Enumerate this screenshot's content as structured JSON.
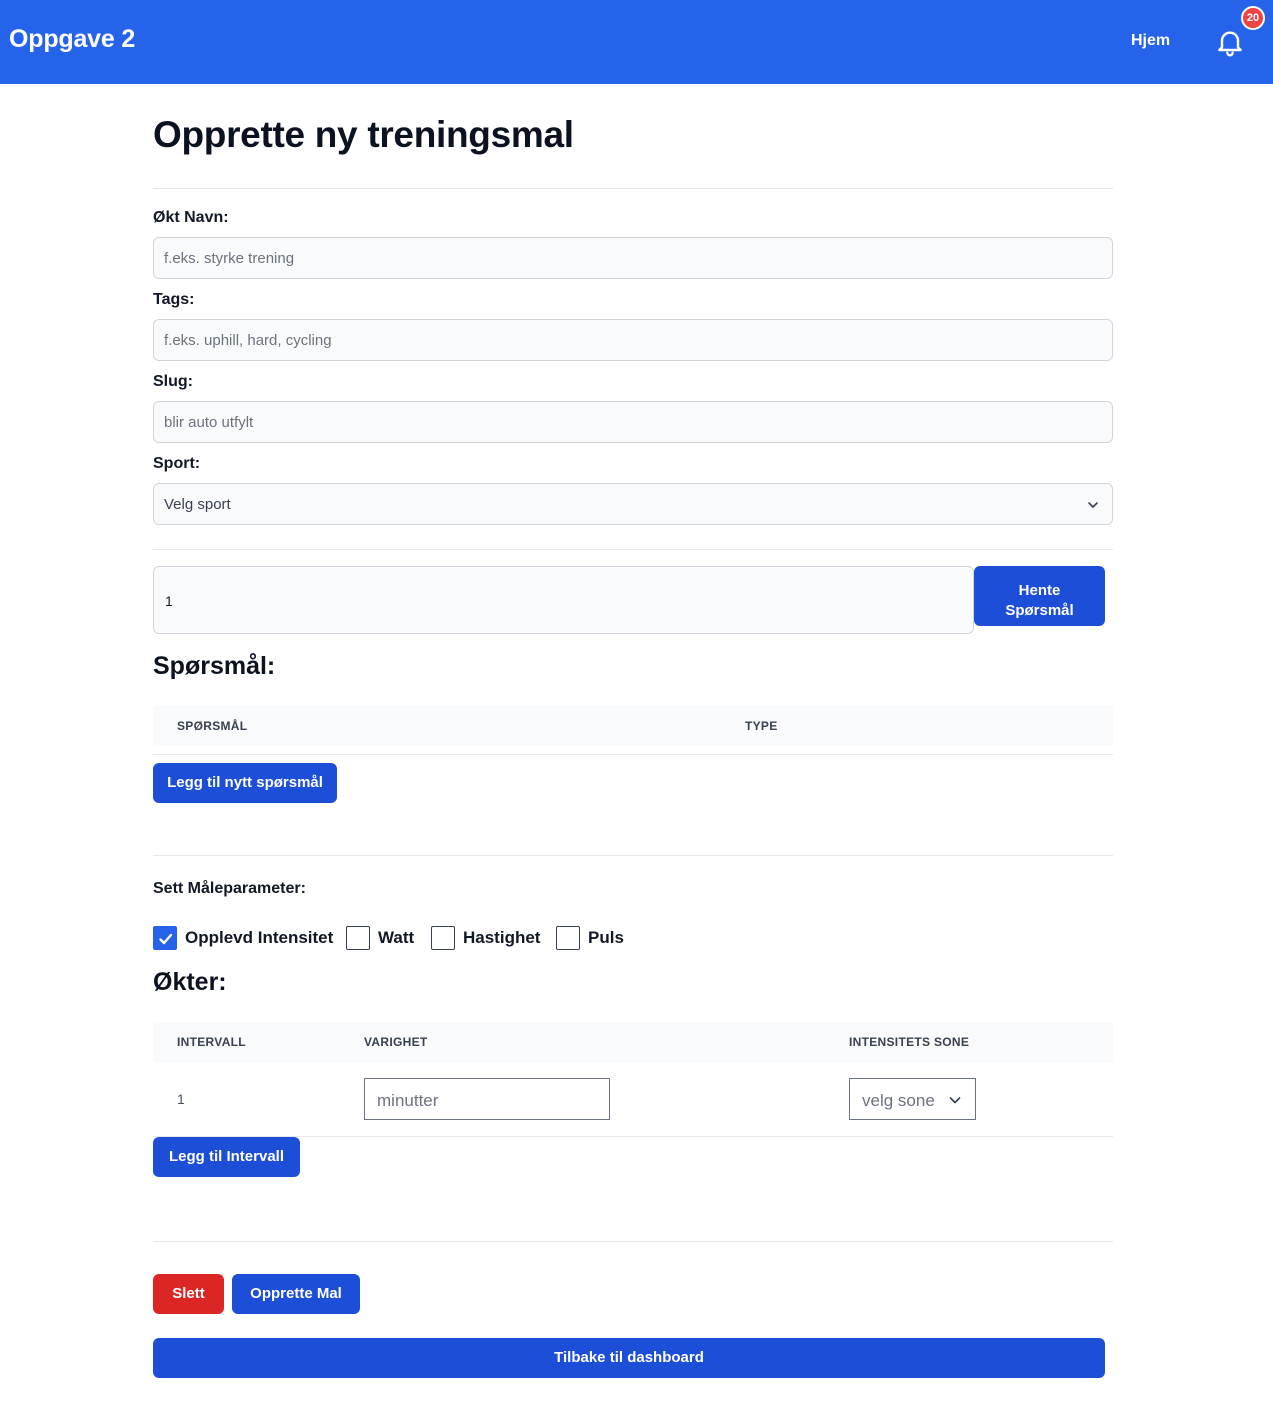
{
  "navbar": {
    "brand": "Oppgave 2",
    "home_link": "Hjem",
    "notification_count": "20"
  },
  "page": {
    "title": "Opprette ny treningsmal"
  },
  "form": {
    "session_name": {
      "label": "Økt Navn:",
      "placeholder": "f.eks. styrke trening",
      "value": ""
    },
    "tags": {
      "label": "Tags:",
      "placeholder": "f.eks. uphill, hard, cycling",
      "value": ""
    },
    "slug": {
      "label": "Slug:",
      "placeholder": "blir auto utfylt",
      "value": ""
    },
    "sport": {
      "label": "Sport:",
      "selected": "Velg sport"
    }
  },
  "fetch": {
    "id_value": "1",
    "button_label": "Hente Spørsmål"
  },
  "questions": {
    "title": "Spørsmål:",
    "columns": [
      "Spørsmål",
      "Type"
    ],
    "rows": [],
    "add_button": "Legg til nytt spørsmål"
  },
  "parameters": {
    "title": "Sett Måleparameter:",
    "options": [
      {
        "label": "Opplevd Intensitet",
        "checked": true
      },
      {
        "label": "Watt",
        "checked": false
      },
      {
        "label": "Hastighet",
        "checked": false
      },
      {
        "label": "Puls",
        "checked": false
      }
    ]
  },
  "sessions": {
    "title": "Økter:",
    "columns": [
      "Intervall",
      "Varighet",
      "Intensitets sone"
    ],
    "rows": [
      {
        "interval": "1",
        "duration_placeholder": "minutter",
        "zone_selected": "velg sone"
      }
    ],
    "add_button": "Legg til Intervall"
  },
  "actions": {
    "delete": "Slett",
    "create": "Opprette Mal",
    "back": "Tilbake til dashboard"
  },
  "colors": {
    "primary": "#2563eb",
    "button_blue": "#1d4ed8",
    "danger": "#dc2626",
    "badge": "#ef4444"
  }
}
